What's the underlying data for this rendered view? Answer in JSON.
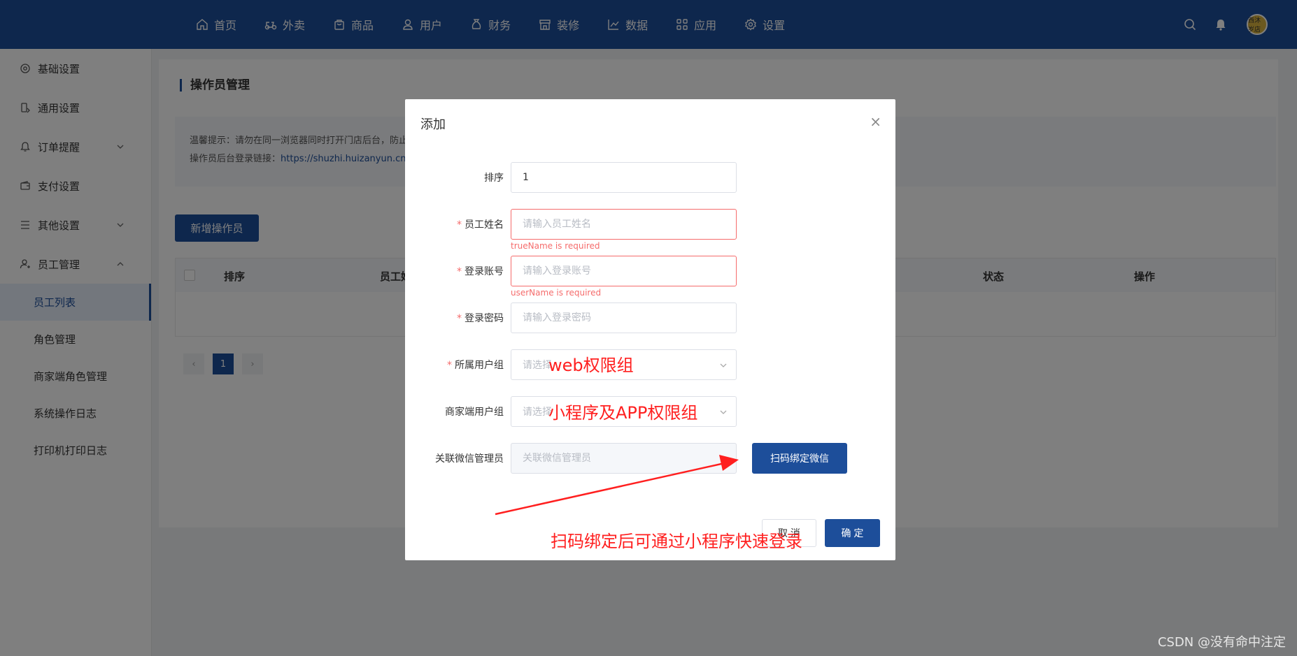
{
  "topnav": {
    "items": [
      {
        "label": "首页",
        "icon": "home-icon"
      },
      {
        "label": "外卖",
        "icon": "scooter-icon"
      },
      {
        "label": "商品",
        "icon": "bag-icon"
      },
      {
        "label": "用户",
        "icon": "user-icon"
      },
      {
        "label": "财务",
        "icon": "moneybag-icon"
      },
      {
        "label": "装修",
        "icon": "store-icon"
      },
      {
        "label": "数据",
        "icon": "chart-icon"
      },
      {
        "label": "应用",
        "icon": "apps-icon"
      },
      {
        "label": "设置",
        "icon": "gear-icon"
      }
    ],
    "avatar_text": "西沐岁店"
  },
  "sidebar": {
    "items": [
      {
        "label": "基础设置"
      },
      {
        "label": "通用设置"
      },
      {
        "label": "订单提醒"
      },
      {
        "label": "支付设置"
      },
      {
        "label": "其他设置"
      },
      {
        "label": "员工管理"
      }
    ],
    "sub": [
      {
        "label": "员工列表"
      },
      {
        "label": "角色管理"
      },
      {
        "label": "商家端角色管理"
      },
      {
        "label": "系统操作日志"
      },
      {
        "label": "打印机打印日志"
      }
    ]
  },
  "page": {
    "title": "操作员管理",
    "tip_line1": "温馨提示：请勿在同一浏览器同时打开门店后台，防止",
    "tip_line2_prefix": "操作员后台登录链接：",
    "tip_link": "https://shuzhi.huizanyun.cn/vie",
    "add_button": "新增操作员",
    "columns": {
      "sort": "排序",
      "name": "员工姓",
      "status": "状态",
      "action": "操作"
    },
    "pager": {
      "prev": "‹",
      "current": "1",
      "next": "›"
    }
  },
  "modal": {
    "title": "添加",
    "close": "×",
    "fields": {
      "sort": {
        "label": "排序",
        "value": "1"
      },
      "name": {
        "label": "员工姓名",
        "placeholder": "请输入员工姓名",
        "error": "trueName is required"
      },
      "account": {
        "label": "登录账号",
        "placeholder": "请输入登录账号",
        "error": "userName is required"
      },
      "password": {
        "label": "登录密码",
        "placeholder": "请输入登录密码"
      },
      "group": {
        "label": "所属用户组",
        "placeholder": "请选择"
      },
      "merchant_group": {
        "label": "商家端用户组",
        "placeholder": "请选择"
      },
      "wechat": {
        "label": "关联微信管理员",
        "placeholder": "关联微信管理员",
        "button": "扫码绑定微信"
      }
    },
    "required_mark": "*",
    "cancel": "取 消",
    "confirm": "确 定"
  },
  "annotations": {
    "web_group": "web权限组",
    "app_group": "小程序及APP权限组",
    "scan_note": "扫码绑定后可通过小程序快速登录",
    "color": "#ff1f1f"
  },
  "watermark": "CSDN @没有命中注定",
  "colors": {
    "brand": "#1d4e9a",
    "error": "#f56c6c"
  }
}
